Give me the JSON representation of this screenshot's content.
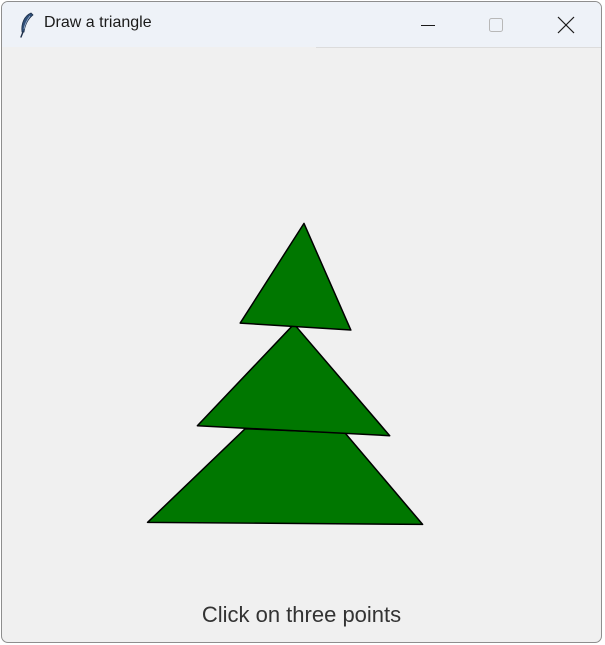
{
  "window": {
    "title": "Draw a triangle"
  },
  "icons": {
    "app": "feather-icon",
    "minimize": "minimize-icon",
    "maximize": "maximize-icon",
    "close": "close-icon"
  },
  "colors": {
    "triangle_fill": "#007700",
    "triangle_stroke": "#000000",
    "background": "#f0f0f0"
  },
  "status": {
    "text": "Click on three points"
  }
}
